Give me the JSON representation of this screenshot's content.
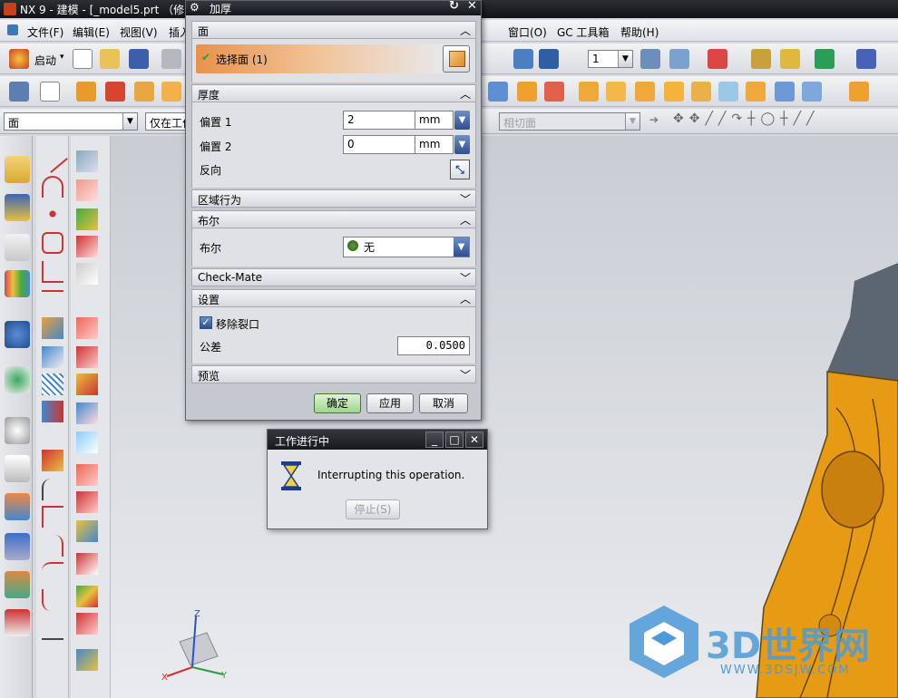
{
  "window": {
    "title": "NX 9 - 建模 - [_model5.prt （修"
  },
  "menu": [
    "文件(F)",
    "编辑(E)",
    "视图(V)",
    "插入",
    "窗口(O)",
    "GC 工具箱",
    "帮助(H)"
  ],
  "toolbar": {
    "start_label": "启动",
    "layer_value": "1"
  },
  "selection_bar": {
    "filter_value": "面",
    "scope_value": "仅在工作",
    "snap_value": "相切面"
  },
  "dialog": {
    "title": "加厚",
    "sections": {
      "face": {
        "header": "面",
        "select_label": "选择面 (1)"
      },
      "thickness": {
        "header": "厚度",
        "offset1_label": "偏置 1",
        "offset1_value": "2",
        "offset1_unit": "mm",
        "offset2_label": "偏置 2",
        "offset2_value": "0",
        "offset2_unit": "mm",
        "reverse_label": "反向"
      },
      "region": {
        "header": "区域行为"
      },
      "boolean": {
        "header": "布尔",
        "boolean_label": "布尔",
        "boolean_value": "无"
      },
      "checkmate": {
        "header": "Check-Mate"
      },
      "settings": {
        "header": "设置",
        "remove_gaps_label": "移除裂口",
        "remove_gaps_checked": true,
        "tolerance_label": "公差",
        "tolerance_value": "0.0500"
      },
      "preview": {
        "header": "预览"
      }
    },
    "buttons": {
      "ok": "确定",
      "apply": "应用",
      "cancel": "取消"
    }
  },
  "progress_dialog": {
    "title": "工作进行中",
    "message": "Interrupting this operation.",
    "stop_label": "停止(S)"
  },
  "triad": {
    "x": "X",
    "y": "Y",
    "z": "Z"
  },
  "watermark": {
    "text": "3D世界网",
    "url": "WWW.3DSJW.COM"
  },
  "colors": {
    "accent": "#f0a14a",
    "part_orange": "#e79a14",
    "dialog_bg": "#c5c9cf"
  }
}
